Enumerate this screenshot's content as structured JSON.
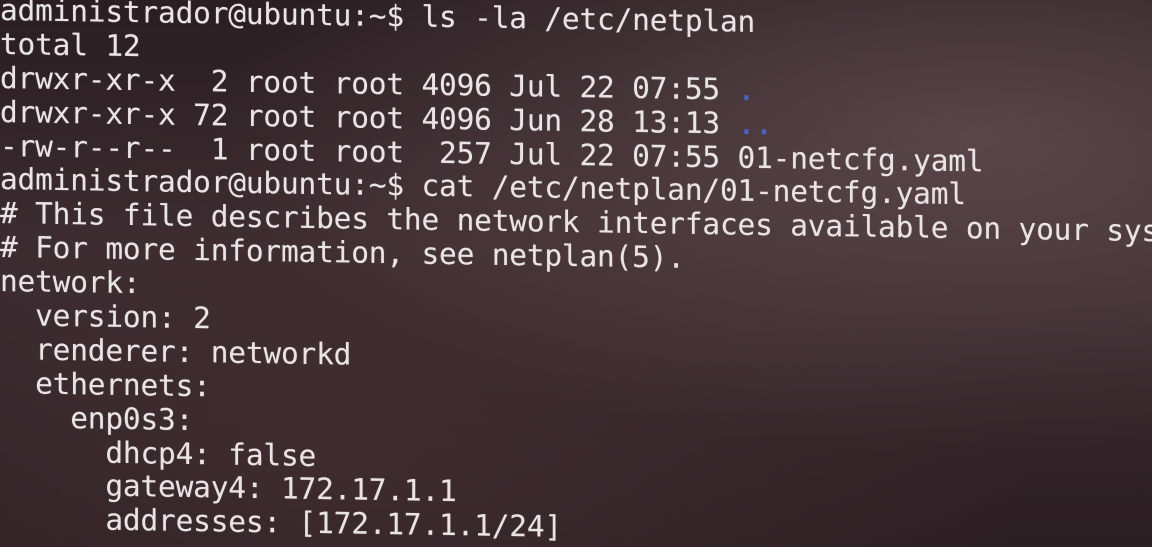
{
  "terminal": {
    "lines": [
      {
        "text": "administrador@ubuntu:~$ ls -la /etc/netplan"
      },
      {
        "text": "total 12"
      },
      {
        "text": "drwxr-xr-x  2 root root 4096 Jul 22 07:55 ",
        "link": "."
      },
      {
        "text": "drwxr-xr-x 72 root root 4096 Jun 28 13:13 ",
        "link": ".."
      },
      {
        "text": "-rw-r--r--  1 root root  257 Jul 22 07:55 01-netcfg.yaml"
      },
      {
        "text": "administrador@ubuntu:~$ cat /etc/netplan/01-netcfg.yaml"
      },
      {
        "text": "# This file describes the network interfaces available on your system"
      },
      {
        "text": "# For more information, see netplan(5)."
      },
      {
        "text": "network:"
      },
      {
        "text": "  version: 2"
      },
      {
        "text": "  renderer: networkd"
      },
      {
        "text": "  ethernets:"
      },
      {
        "text": "    enp0s3:"
      },
      {
        "text": "      dhcp4: false"
      },
      {
        "text": "      gateway4: 172.17.1.1"
      },
      {
        "text": "      addresses: [172.17.1.1/24]"
      }
    ]
  },
  "colors": {
    "text": "#e9e4e6",
    "directory": "#3d63d9",
    "background": "#2a1e22"
  }
}
